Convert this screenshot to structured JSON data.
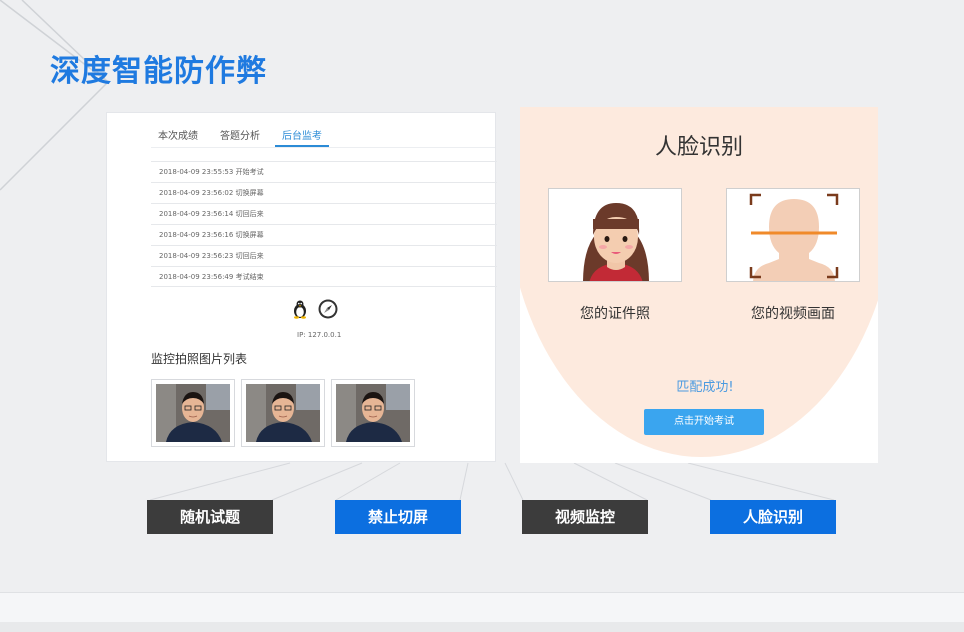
{
  "page": {
    "title": "深度智能防作弊"
  },
  "left_panel": {
    "tabs": [
      {
        "label": "本次成绩"
      },
      {
        "label": "答题分析"
      },
      {
        "label": "后台监考"
      }
    ],
    "active_tab": "后台监考",
    "logs": [
      "2018-04-09 23:55:53 开始考试",
      "2018-04-09 23:56:02 切换屏幕",
      "2018-04-09 23:56:14 切回后来",
      "2018-04-09 23:56:16 切换屏幕",
      "2018-04-09 23:56:23 切回后来",
      "2018-04-09 23:56:49 考试结束"
    ],
    "os_icons": [
      "linux-icon",
      "compass-icon"
    ],
    "ip": "IP: 127.0.0.1",
    "photo_list_title": "监控拍照图片列表",
    "photo_count": 3
  },
  "right_panel": {
    "title": "人脸识别",
    "id_photo_caption": "您的证件照",
    "video_caption": "您的视频画面",
    "match_text": "匹配成功!",
    "start_button": "点击开始考试"
  },
  "features": [
    {
      "label": "随机试题",
      "style": "dark"
    },
    {
      "label": "禁止切屏",
      "style": "blue"
    },
    {
      "label": "视频监控",
      "style": "dark"
    },
    {
      "label": "人脸识别",
      "style": "blue"
    }
  ],
  "colors": {
    "title_blue": "#1f7ae0",
    "label_dark": "#3c3c3c",
    "label_blue": "#0c6fe0",
    "button_blue": "#3aa5ef",
    "face_bg": "#fdeade"
  }
}
